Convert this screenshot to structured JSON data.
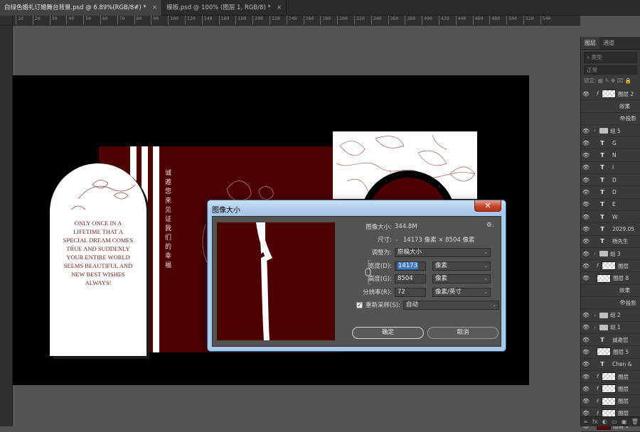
{
  "tabs": [
    {
      "label": "白绿色婚礼订婚舞台背景.psd @ 6.89%(RGB/8#) *",
      "close": "×"
    },
    {
      "label": "模板.psd @ 100% (图层 1, RGB/8) *",
      "close": "×"
    }
  ],
  "ruler_ticks": [
    "10",
    "20",
    "30",
    "40",
    "50",
    "60",
    "70",
    "80",
    "90",
    "100",
    "120",
    "140",
    "160",
    "180",
    "200",
    "220",
    "240",
    "260",
    "280",
    "300",
    "320",
    "340",
    "360",
    "380",
    "400",
    "420",
    "440",
    "460",
    "480",
    "500",
    "520",
    "540"
  ],
  "canvas": {
    "vertical_text": "诚邀您来见证我们的幸福",
    "arch_text": "Only once in a\nlifetime that a\nspecial dream comes\ntrue and suddenly\nyour entire world\nseems beautiful and\nnew best wishes\nalways!"
  },
  "dialog": {
    "title": "图像大小",
    "close": "✕",
    "image_size_label": "图像大小:",
    "image_size_value": "344.8M",
    "gear": "⚙.",
    "dimensions_label": "尺寸:",
    "dimensions_value": "14173 像素 × 8504 像素",
    "fit_label": "调整为:",
    "fit_value": "原稿大小",
    "width_label": "宽度(D):",
    "width_value": "14173",
    "width_unit": "像素",
    "height_label": "高度(G):",
    "height_value": "8504",
    "height_unit": "像素",
    "resolution_label": "分辨率(R):",
    "resolution_value": "72",
    "resolution_unit": "像素/英寸",
    "resample_label": "重新采样(S):",
    "resample_value": "自动",
    "resample_checked": "✓",
    "ok_label": "确定",
    "cancel_label": "取消"
  },
  "layers_panel": {
    "tabs": [
      "图层",
      "通道"
    ],
    "filter_placeholder": "类型",
    "blend_mode": "正常",
    "lock_label": "锁定:",
    "layers": [
      {
        "kind": "img",
        "name": "图层 2",
        "fx": "f"
      },
      {
        "kind": "sub",
        "name": "效果"
      },
      {
        "kind": "sub2",
        "name": "投影"
      },
      {
        "kind": "group",
        "name": "组 5"
      },
      {
        "kind": "text",
        "name": "G"
      },
      {
        "kind": "text",
        "name": "N"
      },
      {
        "kind": "text",
        "name": "I"
      },
      {
        "kind": "text",
        "name": "D"
      },
      {
        "kind": "text",
        "name": "D"
      },
      {
        "kind": "text",
        "name": "E"
      },
      {
        "kind": "text",
        "name": "W"
      },
      {
        "kind": "text",
        "name": "2029.05"
      },
      {
        "kind": "text",
        "name": "杨先生"
      },
      {
        "kind": "group",
        "name": "组 3"
      },
      {
        "kind": "img",
        "name": "图层",
        "fx": "f"
      },
      {
        "kind": "img",
        "name": "图层 8"
      },
      {
        "kind": "sub",
        "name": "效果"
      },
      {
        "kind": "sub2",
        "name": "投影"
      },
      {
        "kind": "group",
        "name": "组 2"
      },
      {
        "kind": "group",
        "name": "组 1"
      },
      {
        "kind": "text",
        "name": "诚邀您"
      },
      {
        "kind": "img",
        "name": "图层 5"
      },
      {
        "kind": "text",
        "name": "Chen &"
      },
      {
        "kind": "img",
        "name": "图层",
        "fx": "f"
      },
      {
        "kind": "img",
        "name": "图层",
        "fx": "f"
      },
      {
        "kind": "img",
        "name": "图层",
        "fx": "f"
      },
      {
        "kind": "img",
        "name": "图层",
        "fx": "f"
      },
      {
        "kind": "red",
        "name": "图层 1"
      }
    ],
    "bottom_icons": [
      "∞",
      "fx",
      "◐",
      "▭",
      "▣",
      "🗑"
    ]
  },
  "colors": {
    "dark_red": "#4d0000",
    "canvas_bg": "#000000",
    "workspace": "#535353",
    "dialog_frame": "#a9c7e8",
    "selection": "#3b79c9"
  }
}
